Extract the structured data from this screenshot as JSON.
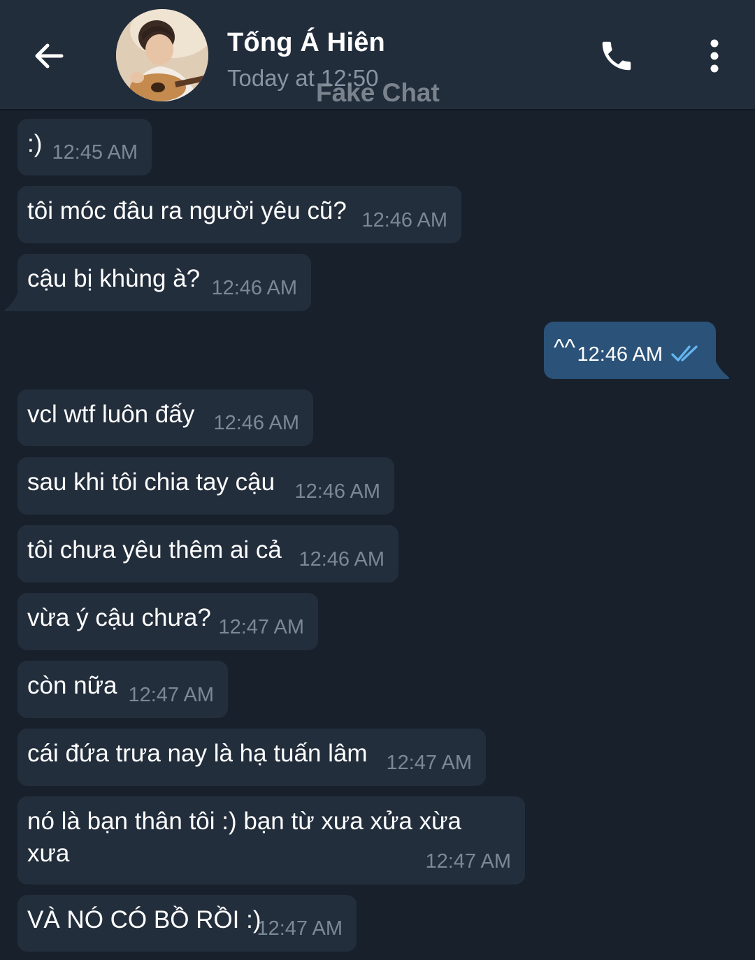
{
  "header": {
    "contact_name": "Tống Á Hiên",
    "status": "Today at 12:50",
    "watermark": "Fake Chat"
  },
  "messages": [
    {
      "direction": "in",
      "text": ":)",
      "time": "12:45 AM"
    },
    {
      "direction": "in",
      "text": "tôi móc đâu ra người yêu cũ?",
      "time": "12:46 AM"
    },
    {
      "direction": "in",
      "text": "cậu bị khùng à?",
      "time": "12:46 AM"
    },
    {
      "direction": "out",
      "text": "^^",
      "time": "12:46 AM",
      "read": true
    },
    {
      "direction": "in",
      "text": "vcl wtf luôn đấy",
      "time": "12:46 AM"
    },
    {
      "direction": "in",
      "text": "sau khi tôi chia tay cậu",
      "time": "12:46 AM"
    },
    {
      "direction": "in",
      "text": "tôi chưa yêu thêm ai cả",
      "time": "12:46 AM"
    },
    {
      "direction": "in",
      "text": "vừa ý cậu chưa?",
      "time": "12:47 AM"
    },
    {
      "direction": "in",
      "text": "còn nữa",
      "time": "12:47 AM"
    },
    {
      "direction": "in",
      "text": "cái đứa trưa nay là hạ tuấn lâm",
      "time": "12:47 AM"
    },
    {
      "direction": "in",
      "text_line1": "nó là bạn thân tôi :) bạn từ xưa xửa xừa",
      "text_line2": "xưa",
      "time": "12:47 AM"
    },
    {
      "direction": "in",
      "text": "VÀ NÓ CÓ BỒ RỒI :)",
      "time": "12:47 AM"
    }
  ],
  "icons": {
    "back": "arrow-left-icon",
    "call": "phone-icon",
    "menu": "more-vertical-icon",
    "read_status": "double-check-icon"
  },
  "colors": {
    "header_bg": "#222d3b",
    "chat_bg": "#18202c",
    "incoming_bubble": "#232e3c",
    "outgoing_bubble": "#2b5278",
    "timestamp": "#7b8896",
    "check": "#64b5ef"
  }
}
